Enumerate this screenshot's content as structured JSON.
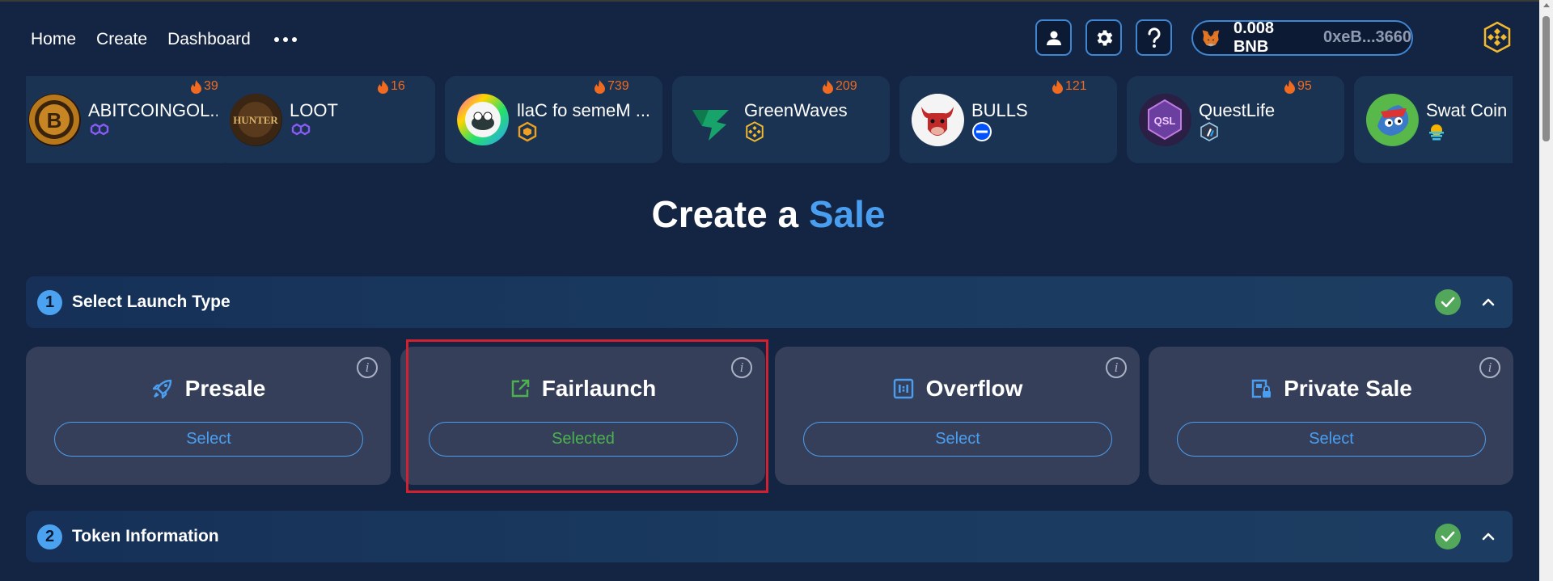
{
  "nav": {
    "links": [
      "Home",
      "Create",
      "Dashboard"
    ]
  },
  "wallet": {
    "balance": "0.008 BNB",
    "address": "0xeB...3660"
  },
  "trending": [
    {
      "name": "ABITCOINGOL...",
      "count": "39",
      "chain": "polygon-icon"
    },
    {
      "name": "LOOT",
      "count": "16",
      "chain": "polygon-icon"
    },
    {
      "name": "llaC fo semeM ...",
      "count": "739",
      "chain": "hexagon-chain-icon"
    },
    {
      "name": "GreenWaves",
      "count": "209",
      "chain": "bnb-icon"
    },
    {
      "name": "BULLS",
      "count": "121",
      "chain": "base-icon"
    },
    {
      "name": "QuestLife",
      "count": "95",
      "chain": "arbitrum-icon"
    },
    {
      "name": "Swat Coin",
      "count": "",
      "chain": "sun-chain-icon"
    }
  ],
  "heading": {
    "prefix": "Create a",
    "accent": "Sale"
  },
  "sections": [
    {
      "number": "1",
      "title": "Select Launch Type"
    },
    {
      "number": "2",
      "title": "Token Information"
    }
  ],
  "launch_types": [
    {
      "title": "Presale",
      "button": "Select",
      "selected": false,
      "icon": "rocket-icon"
    },
    {
      "title": "Fairlaunch",
      "button": "Selected",
      "selected": true,
      "icon": "external-link-icon"
    },
    {
      "title": "Overflow",
      "button": "Select",
      "selected": false,
      "icon": "overflow-icon"
    },
    {
      "title": "Private Sale",
      "button": "Select",
      "selected": false,
      "icon": "private-sale-icon"
    }
  ],
  "info_glyph": "i",
  "colors": {
    "background": "#142443",
    "accent": "#4a9ef0",
    "success": "#52a75a",
    "highlight": "#d2202e",
    "fire": "#f06a1f"
  }
}
